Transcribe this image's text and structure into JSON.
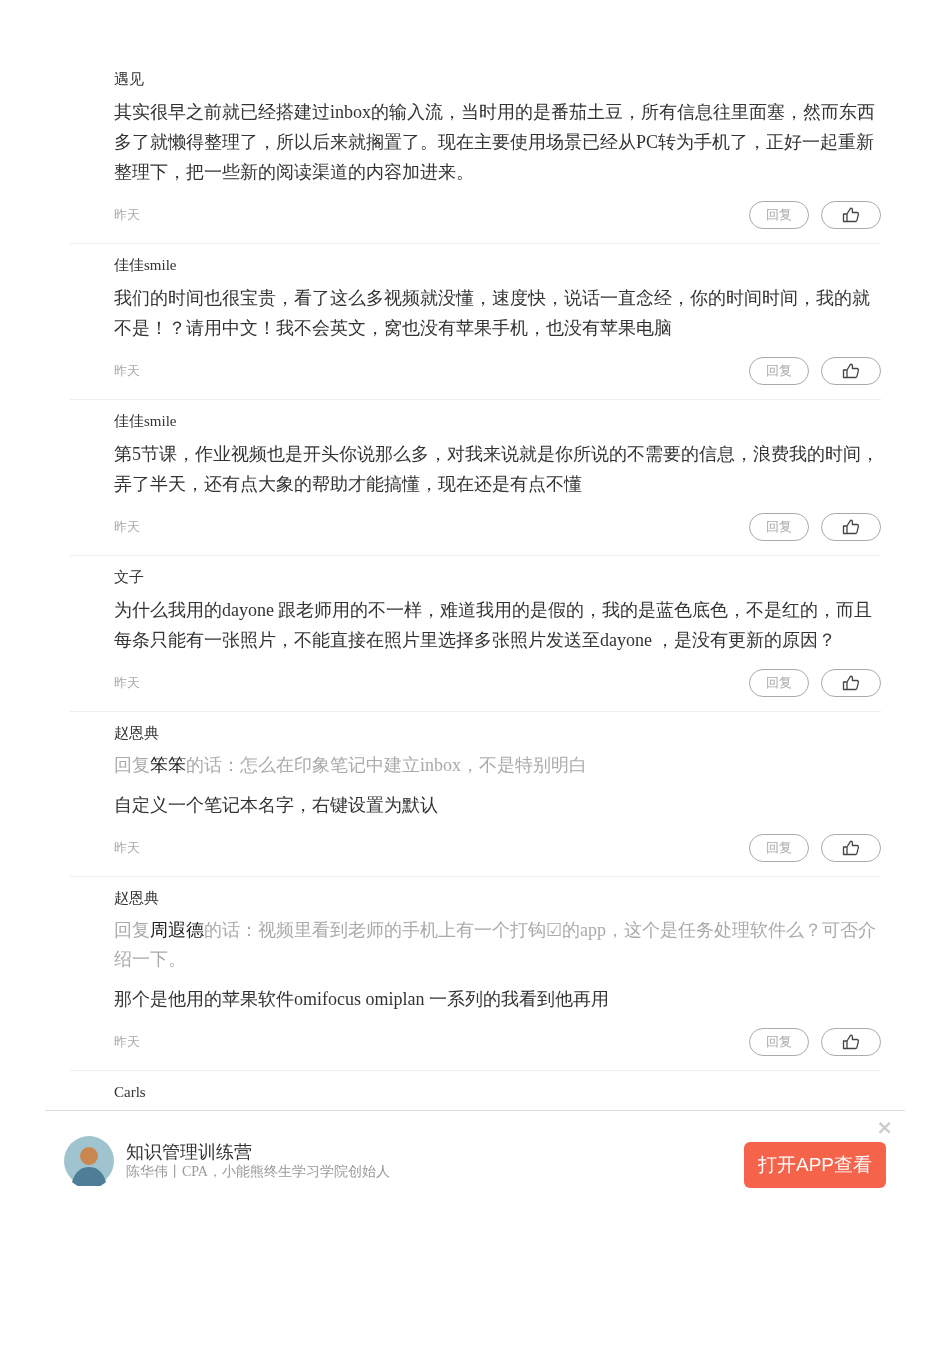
{
  "comments": [
    {
      "author": "遇见",
      "text": "其实很早之前就已经搭建过inbox的输入流，当时用的是番茄土豆，所有信息往里面塞，然而东西多了就懒得整理了，所以后来就搁置了。现在主要使用场景已经从PC转为手机了，正好一起重新整理下，把一些新的阅读渠道的内容加进来。",
      "time": "昨天",
      "reply_label": "回复"
    },
    {
      "author": "佳佳smile",
      "text": "我们的时间也很宝贵，看了这么多视频就没懂，速度快，说话一直念经，你的时间时间，我的就不是！？请用中文！我不会英文，窝也没有苹果手机，也没有苹果电脑",
      "time": "昨天",
      "reply_label": "回复"
    },
    {
      "author": "佳佳smile",
      "text": "第5节课，作业视频也是开头你说那么多，对我来说就是你所说的不需要的信息，浪费我的时间，弄了半天，还有点大象的帮助才能搞懂，现在还是有点不懂",
      "time": "昨天",
      "reply_label": "回复"
    },
    {
      "author": "文子",
      "text": "为什么我用的dayone 跟老师用的不一样，难道我用的是假的，我的是蓝色底色，不是红的，而且每条只能有一张照片，不能直接在照片里选择多张照片发送至dayone ，是没有更新的原因？",
      "time": "昨天",
      "reply_label": "回复"
    },
    {
      "author": "赵恩典",
      "quote": "回复**笨笨**的话：怎么在印象笔记中建立inbox，不是特别明白",
      "text": "自定义一个笔记本名字，右键设置为默认",
      "time": "昨天",
      "reply_label": "回复"
    },
    {
      "author": "赵恩典",
      "quote": "回复**周遐德**的话：视频里看到老师的手机上有一个打钩☑的app，这个是任务处理软件么？可否介绍一下。",
      "text": "那个是他用的苹果软件omifocus omiplan 一系列的我看到他再用",
      "time": "昨天",
      "reply_label": "回复"
    },
    {
      "author": "Carls"
    }
  ],
  "banner": {
    "title": "知识管理训练营",
    "subtitle": "陈华伟丨CPA，小能熊终生学习学院创始人",
    "button": "打开APP查看",
    "close": "×"
  }
}
